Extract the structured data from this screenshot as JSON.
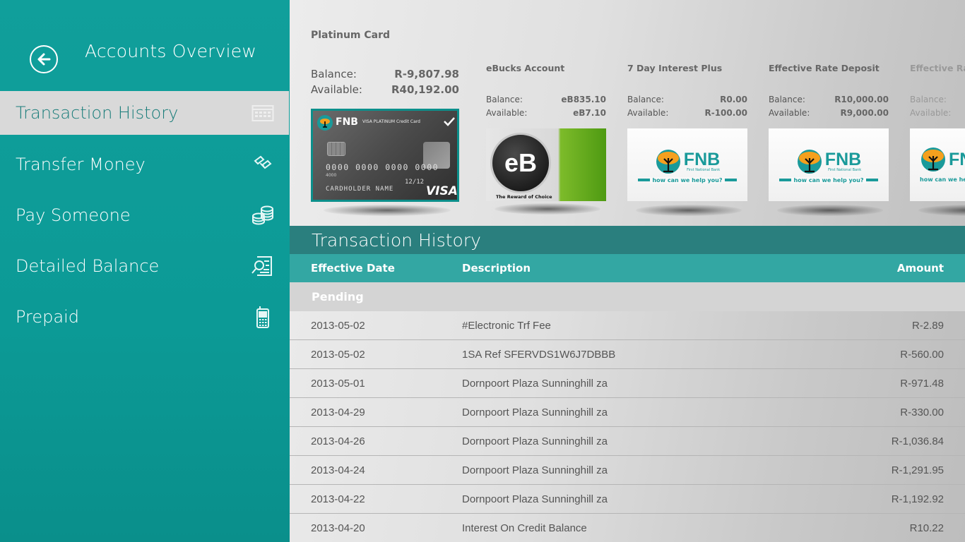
{
  "sidebar": {
    "title": "Accounts Overview",
    "items": [
      {
        "label": "Transaction History",
        "icon": "calendar-icon",
        "active": true
      },
      {
        "label": "Transfer Money",
        "icon": "transfer-icon",
        "active": false
      },
      {
        "label": "Pay Someone",
        "icon": "coins-icon",
        "active": false
      },
      {
        "label": "Detailed Balance",
        "icon": "balance-search-icon",
        "active": false
      },
      {
        "label": "Prepaid",
        "icon": "mobile-phone-icon",
        "active": false
      }
    ]
  },
  "accounts": {
    "balance_label": "Balance:",
    "available_label": "Available:",
    "list": [
      {
        "name": "Platinum Card",
        "balance": "R-9,807.98",
        "available": "R40,192.00",
        "image": "fnb-visa-platinum-card"
      },
      {
        "name": "eBucks Account",
        "balance": "eB835.10",
        "available": "eB7.10",
        "image": "ebucks-logo"
      },
      {
        "name": "7 Day Interest Plus",
        "balance": "R0.00",
        "available": "R-100.00",
        "image": "fnb-logo"
      },
      {
        "name": "Effective Rate Deposit",
        "balance": "R10,000.00",
        "available": "R9,000.00",
        "image": "fnb-logo"
      },
      {
        "name": "Effective Rate",
        "balance": "",
        "available": "",
        "image": "fnb-logo"
      }
    ]
  },
  "card_art": {
    "bank": "FNB",
    "product": "VISA PLATINUM Credit Card",
    "number": "0000 0000 0000 0000",
    "small_number": "4000",
    "expiry": "12/12",
    "holder": "CARDHOLDER NAME",
    "network": "VISA"
  },
  "fnb_logo": {
    "name": "FNB",
    "subtitle": "First National Bank",
    "tagline": "how can we help you?"
  },
  "ebucks_logo": {
    "text": "eB",
    "tagline": "The Reward of Choice"
  },
  "transactions": {
    "title": "Transaction History",
    "columns": {
      "date": "Effective Date",
      "description": "Description",
      "amount": "Amount"
    },
    "group": "Pending",
    "rows": [
      {
        "date": "2013-05-02",
        "description": "#Electronic Trf Fee",
        "amount": "R-2.89"
      },
      {
        "date": "2013-05-02",
        "description": "1SA Ref SFERVDS1W6J7DBBB",
        "amount": "R-560.00"
      },
      {
        "date": "2013-05-01",
        "description": "Dornpoort Plaza Sunninghill  za",
        "amount": "R-971.48"
      },
      {
        "date": "2013-04-29",
        "description": "Dornpoort Plaza Sunninghill  za",
        "amount": "R-330.00"
      },
      {
        "date": "2013-04-26",
        "description": "Dornpoort Plaza Sunninghill  za",
        "amount": "R-1,036.84"
      },
      {
        "date": "2013-04-24",
        "description": "Dornpoort Plaza Sunninghill  za",
        "amount": "R-1,291.95"
      },
      {
        "date": "2013-04-22",
        "description": "Dornpoort Plaza Sunninghill  za",
        "amount": "R-1,192.92"
      },
      {
        "date": "2013-04-20",
        "description": "Interest On Credit Balance",
        "amount": "R10.22"
      }
    ]
  },
  "colors": {
    "accent": "#0c9a96",
    "header": "#2a7f7e",
    "column_bar": "#33a7a3",
    "fnb_orange": "#f5a01e",
    "fnb_teal": "#1a9a9a"
  }
}
